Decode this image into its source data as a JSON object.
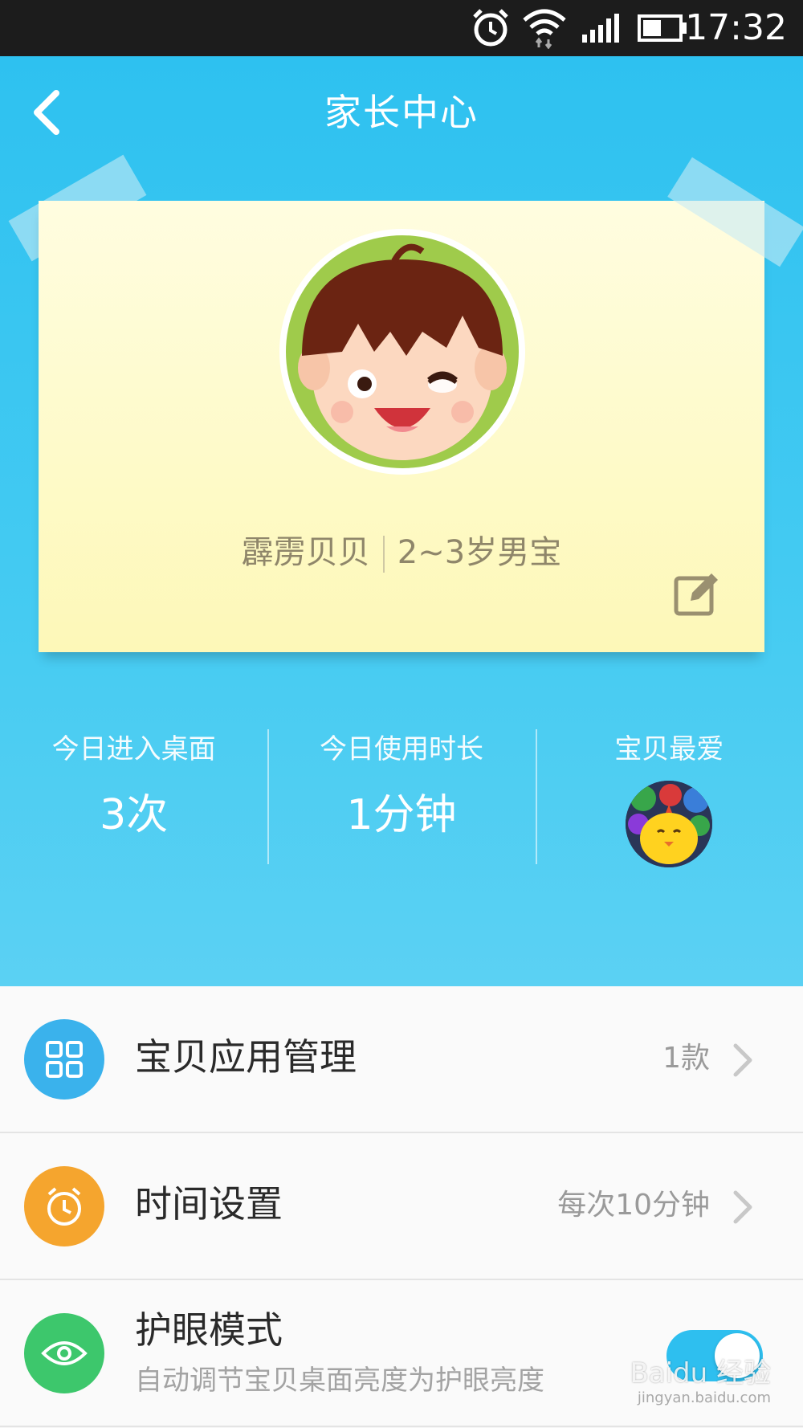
{
  "status_bar": {
    "time": "17:32",
    "icons": [
      "alarm-icon",
      "wifi-icon",
      "signal-icon",
      "battery-icon"
    ]
  },
  "header": {
    "title": "家长中心",
    "back_icon": "chevron-left-icon"
  },
  "profile": {
    "name": "霹雳贝贝",
    "age_gender": "2~3岁男宝",
    "edit_icon": "edit-icon"
  },
  "stats": [
    {
      "label": "今日进入桌面",
      "value": "3次"
    },
    {
      "label": "今日使用时长",
      "value": "1分钟"
    },
    {
      "label": "宝贝最爱",
      "icon": "favorite-app-icon"
    }
  ],
  "menu": [
    {
      "label": "宝贝应用管理",
      "value": "1款",
      "icon": "grid-icon",
      "icon_color": "#3ab2ec"
    },
    {
      "label": "时间设置",
      "value": "每次10分钟",
      "icon": "clock-icon",
      "icon_color": "#f5a52e"
    },
    {
      "label": "护眼模式",
      "subtitle": "自动调节宝贝桌面亮度为护眼亮度",
      "icon": "eye-icon",
      "icon_color": "#3dc76c",
      "toggle_on": true
    }
  ],
  "watermark": {
    "text": "Baidu 经验",
    "url_text": "jingyan.baidu.com"
  },
  "colors": {
    "accent": "#2ec1f0",
    "card": "#fdf8b8"
  }
}
